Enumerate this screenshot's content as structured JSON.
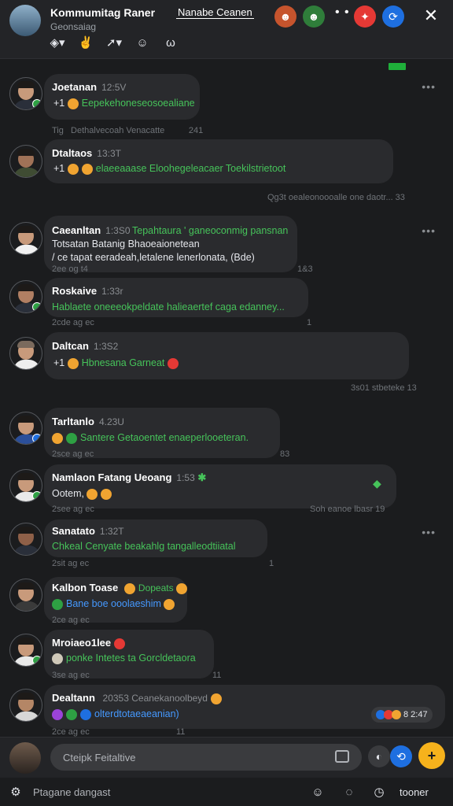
{
  "header": {
    "title": "Kommumitag Raner",
    "subtitle": "Geonsaiag",
    "pill_label": "Nanabe Ceanen",
    "tools": [
      "share-icon",
      "reaction-icon",
      "forward-icon",
      "emoji-icon",
      "dictionary-icon"
    ]
  },
  "messages": [
    {
      "name": "Joetanan",
      "time": "12:5V",
      "line1": "+1",
      "line2": "Eepekehoneseosoealiane",
      "meta_left": "Tig",
      "meta_mid": "Dethalvecoah Venacatte",
      "meta_right": "241"
    },
    {
      "name": "Dtaltaos",
      "time": "13:3T",
      "line1": "+1",
      "line2": "elaeeaaase  Eloohegeleacaer Toekilstrietoot",
      "meta_right": "Qg3t  oealeonoooalle one daotr...  33"
    },
    {
      "name": "Caeanltan",
      "time": "1:3S0",
      "line1": "Tepahtaura  ' ganeoconmig pansnan",
      "line2": "Totsatan  Batanig  Bhaoeaionetean",
      "line3": "/ ce tapat  eeradeah,letalene lenerlonata, (Bde)",
      "meta_left": "2ee  og  t4",
      "meta_right": "1&3"
    },
    {
      "name": "Roskaive",
      "time": "1:33r",
      "line1": "Hablaete  oneeeokpeldate  halieaertef caga edanney...",
      "meta_left": "2cde  ag  ec",
      "meta_right": "1"
    },
    {
      "name": "Daltcan",
      "time": "1:3S2",
      "line1": "+1",
      "line2": "Hbnesana  Garneat",
      "meta_right": "3s01  stbeteke  13"
    },
    {
      "name": "Tarltanlo",
      "time": "4.23U",
      "line1": "Santere  Getaoentet  enaeperlooeteran.",
      "meta_left": "2sce  ag  ec",
      "meta_right": "83"
    },
    {
      "name": "Namlaon Fatang Ueoang",
      "time": "1:53",
      "line1": "Ootem,",
      "meta_left": "2see  ag  ec",
      "meta_right": "Soh  eanoe  lbasr  19"
    },
    {
      "name": "Sanatato",
      "time": "1:32T",
      "line1": "Chkeal  Cenyate  beakahlg  tangalleodtiiatal",
      "meta_left": "2sit  ag  ec",
      "meta_right": "1"
    },
    {
      "name": "Kalbon Toase",
      "time": "Dopeats",
      "line1": "Bane  boe  ooolaeshim",
      "meta_left": "2ce  ag  ec"
    },
    {
      "name": "Mroiaeo1lee",
      "time": "",
      "line1": "ponke  Intetes  ta  Gorcldetaora",
      "meta_left": "3se  ag  ec",
      "meta_right": "11"
    },
    {
      "name": "Dealtann",
      "time": "20353  Ceanekanoolbeyd",
      "line1": "olterdtotaeaeanian)",
      "meta_left": "2ce  ag  ec",
      "meta_right": "11"
    }
  ],
  "reaction_count": "8  2:47",
  "composer": {
    "placeholder": "Cteipk Feitaltive"
  },
  "footer": {
    "left_label": "Ptagane dangast",
    "right_label": "tooner"
  },
  "colors": {
    "accent_green": "#46c35a",
    "link_blue": "#4599ff",
    "send_yellow": "#f6b21c"
  }
}
